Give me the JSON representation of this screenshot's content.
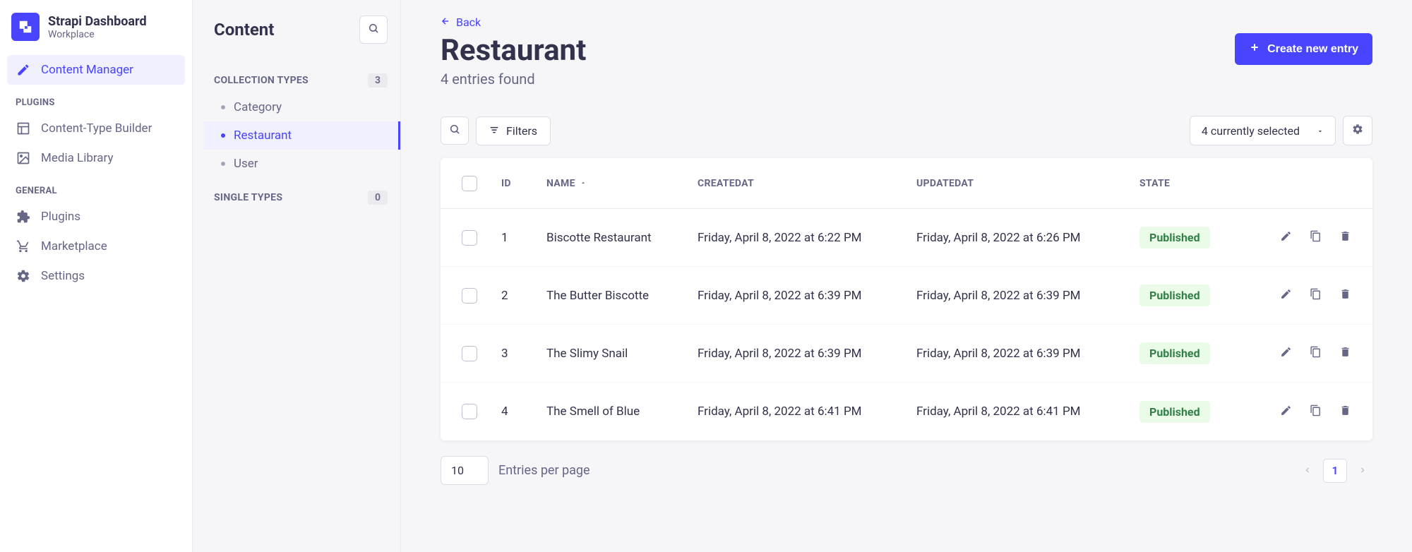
{
  "brand": {
    "title": "Strapi Dashboard",
    "subtitle": "Workplace"
  },
  "sidebar": {
    "content_manager": "Content Manager",
    "plugins_label": "PLUGINS",
    "content_type_builder": "Content-Type Builder",
    "media_library": "Media Library",
    "general_label": "GENERAL",
    "plugins": "Plugins",
    "marketplace": "Marketplace",
    "settings": "Settings"
  },
  "content_panel": {
    "title": "Content",
    "collection_types_label": "COLLECTION TYPES",
    "collection_count": "3",
    "items": [
      {
        "label": "Category"
      },
      {
        "label": "Restaurant"
      },
      {
        "label": "User"
      }
    ],
    "single_types_label": "SINGLE TYPES",
    "single_count": "0"
  },
  "main": {
    "back": "Back",
    "title": "Restaurant",
    "subtitle": "4 entries found",
    "create_btn": "Create new entry",
    "filters": "Filters",
    "selected": "4 currently selected"
  },
  "columns": {
    "id": "ID",
    "name": "NAME",
    "created": "CREATEDAT",
    "updated": "UPDATEDAT",
    "state": "STATE"
  },
  "rows": [
    {
      "id": "1",
      "name": "Biscotte Restaurant",
      "created": "Friday, April 8, 2022 at 6:22 PM",
      "updated": "Friday, April 8, 2022 at 6:26 PM",
      "state": "Published"
    },
    {
      "id": "2",
      "name": "The Butter Biscotte",
      "created": "Friday, April 8, 2022 at 6:39 PM",
      "updated": "Friday, April 8, 2022 at 6:39 PM",
      "state": "Published"
    },
    {
      "id": "3",
      "name": "The Slimy Snail",
      "created": "Friday, April 8, 2022 at 6:39 PM",
      "updated": "Friday, April 8, 2022 at 6:39 PM",
      "state": "Published"
    },
    {
      "id": "4",
      "name": "The Smell of Blue",
      "created": "Friday, April 8, 2022 at 6:41 PM",
      "updated": "Friday, April 8, 2022 at 6:41 PM",
      "state": "Published"
    }
  ],
  "pagination": {
    "per_page": "10",
    "label": "Entries per page",
    "current": "1"
  }
}
